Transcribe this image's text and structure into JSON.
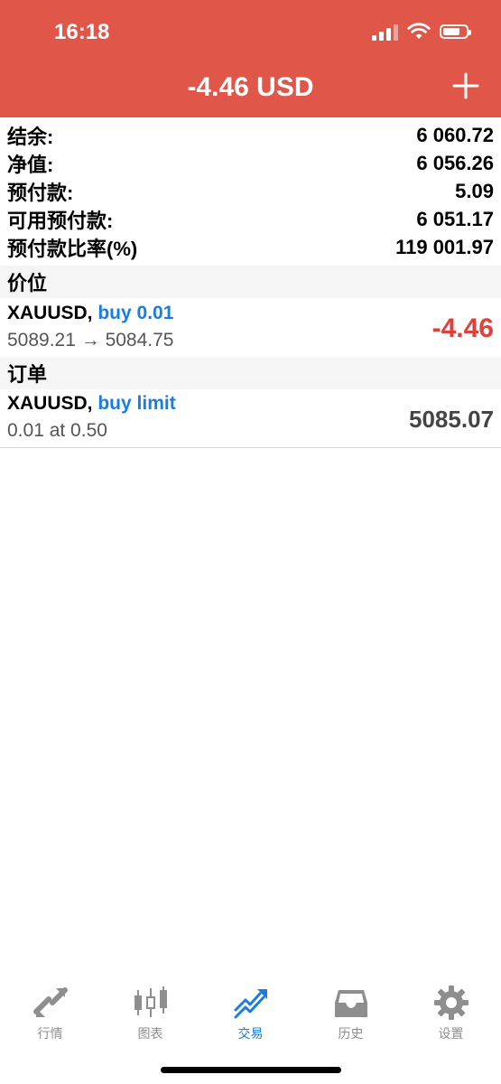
{
  "status_bar": {
    "time": "16:18"
  },
  "header": {
    "title": "-4.46 USD"
  },
  "summary": [
    {
      "label": "结余:",
      "value": "6 060.72"
    },
    {
      "label": "净值:",
      "value": "6 056.26"
    },
    {
      "label": "预付款:",
      "value": "5.09"
    },
    {
      "label": "可用预付款:",
      "value": "6 051.17"
    },
    {
      "label": "预付款比率(%)",
      "value": "119 001.97"
    }
  ],
  "positions": {
    "header": "价位",
    "item": {
      "symbol": "XAUUSD,",
      "action": "buy 0.01",
      "prices": "5089.21 → 5084.75",
      "profit": "-4.46"
    }
  },
  "orders": {
    "header": "订单",
    "item": {
      "symbol": "XAUUSD,",
      "action": "buy limit",
      "detail": "0.01 at 0.50",
      "price": "5085.07"
    }
  },
  "tabs": [
    {
      "label": "行情",
      "icon": "quotes-icon",
      "active": false
    },
    {
      "label": "图表",
      "icon": "candlestick-chart-icon",
      "active": false
    },
    {
      "label": "交易",
      "icon": "trade-icon",
      "active": true
    },
    {
      "label": "历史",
      "icon": "history-inbox-icon",
      "active": false
    },
    {
      "label": "设置",
      "icon": "settings-gear-icon",
      "active": false
    }
  ],
  "colors": {
    "header_bg": "#e0574a",
    "accent_blue": "#1a7be0",
    "loss_red": "#e0403a"
  }
}
